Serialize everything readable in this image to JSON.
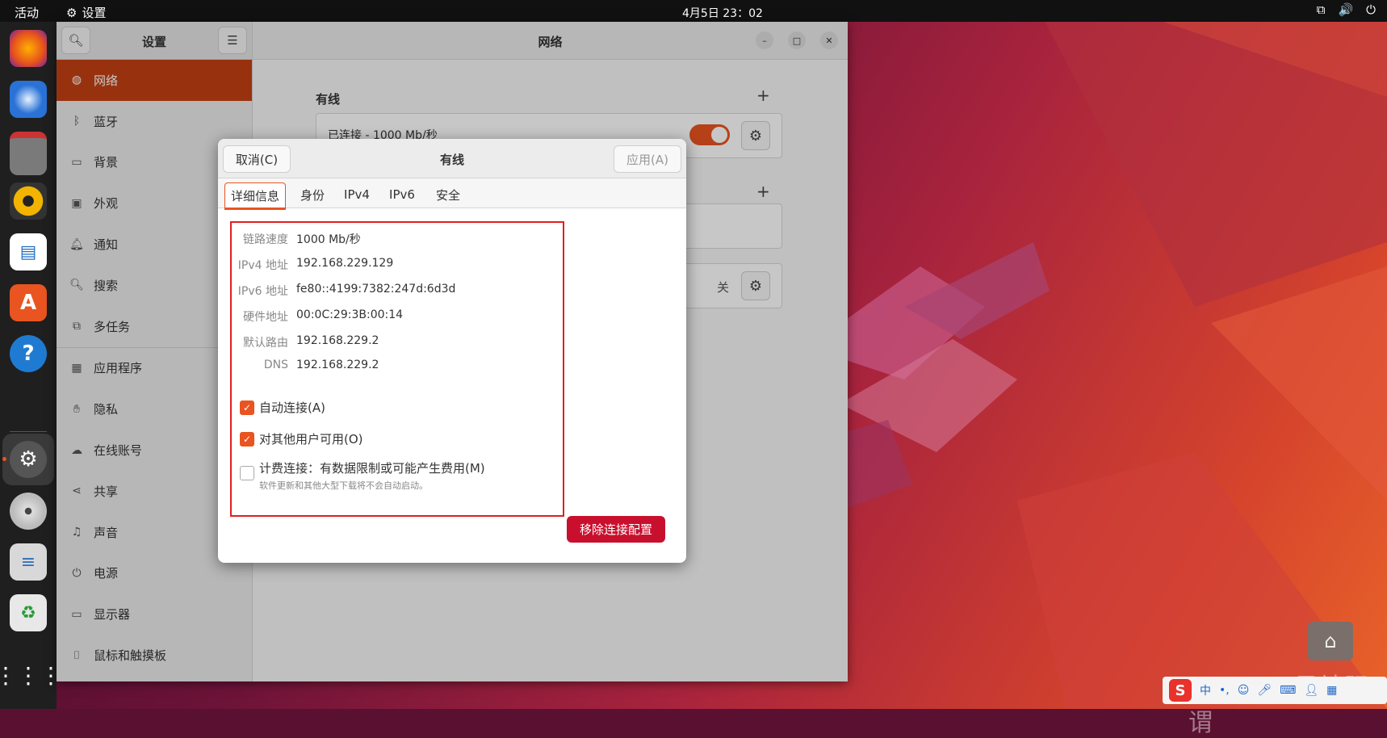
{
  "topbar": {
    "activities": "活动",
    "app_name": "设置",
    "clock": "4月5日  23：02"
  },
  "sidebar": {
    "title": "设置",
    "items": [
      {
        "label": "网络",
        "icon": "network-icon",
        "active": true
      },
      {
        "label": "蓝牙",
        "icon": "bluetooth-icon"
      },
      {
        "label": "背景",
        "icon": "background-icon"
      },
      {
        "label": "外观",
        "icon": "appearance-icon"
      },
      {
        "label": "通知",
        "icon": "bell-icon"
      },
      {
        "label": "搜索",
        "icon": "search-icon"
      },
      {
        "label": "多任务",
        "icon": "multitask-icon"
      },
      {
        "label": "应用程序",
        "icon": "apps-icon"
      },
      {
        "label": "隐私",
        "icon": "privacy-icon"
      },
      {
        "label": "在线账号",
        "icon": "cloud-icon"
      },
      {
        "label": "共享",
        "icon": "share-icon"
      },
      {
        "label": "声音",
        "icon": "music-icon"
      },
      {
        "label": "电源",
        "icon": "power-icon"
      },
      {
        "label": "显示器",
        "icon": "display-icon"
      },
      {
        "label": "鼠标和触摸板",
        "icon": "mouse-icon"
      }
    ]
  },
  "main": {
    "title": "网络",
    "wired_section": "有线",
    "wired_status": "已连接 - 1000 Mb/秒",
    "off_label": "关"
  },
  "dialog": {
    "title": "有线",
    "cancel": "取消(C)",
    "apply": "应用(A)",
    "tabs": [
      "详细信息",
      "身份",
      "IPv4",
      "IPv6",
      "安全"
    ],
    "active_tab": 0,
    "details": [
      {
        "label": "链路速度",
        "value": "1000 Mb/秒"
      },
      {
        "label": "IPv4 地址",
        "value": "192.168.229.129"
      },
      {
        "label": "IPv6 地址",
        "value": "fe80::4199:7382:247d:6d3d"
      },
      {
        "label": "硬件地址",
        "value": "00:0C:29:3B:00:14"
      },
      {
        "label": "默认路由",
        "value": "192.168.229.2"
      },
      {
        "label": "DNS",
        "value": "192.168.229.2"
      }
    ],
    "auto_connect": {
      "label": "自动连接(A)",
      "checked": true
    },
    "all_users": {
      "label": "对其他用户可用(O)",
      "checked": true
    },
    "metered": {
      "label": "计费连接：有数据限制或可能产生费用(M)",
      "hint": "软件更新和其他大型下载将不会自动启动。",
      "checked": false
    },
    "remove_button": "移除连接配置"
  },
  "watermark": "CSDN @吴神阳谓",
  "ime": {
    "logo": "S",
    "mode": "中"
  },
  "colors": {
    "accent": "#e95420",
    "danger": "#c8102e",
    "highlight_box": "#e02020"
  }
}
